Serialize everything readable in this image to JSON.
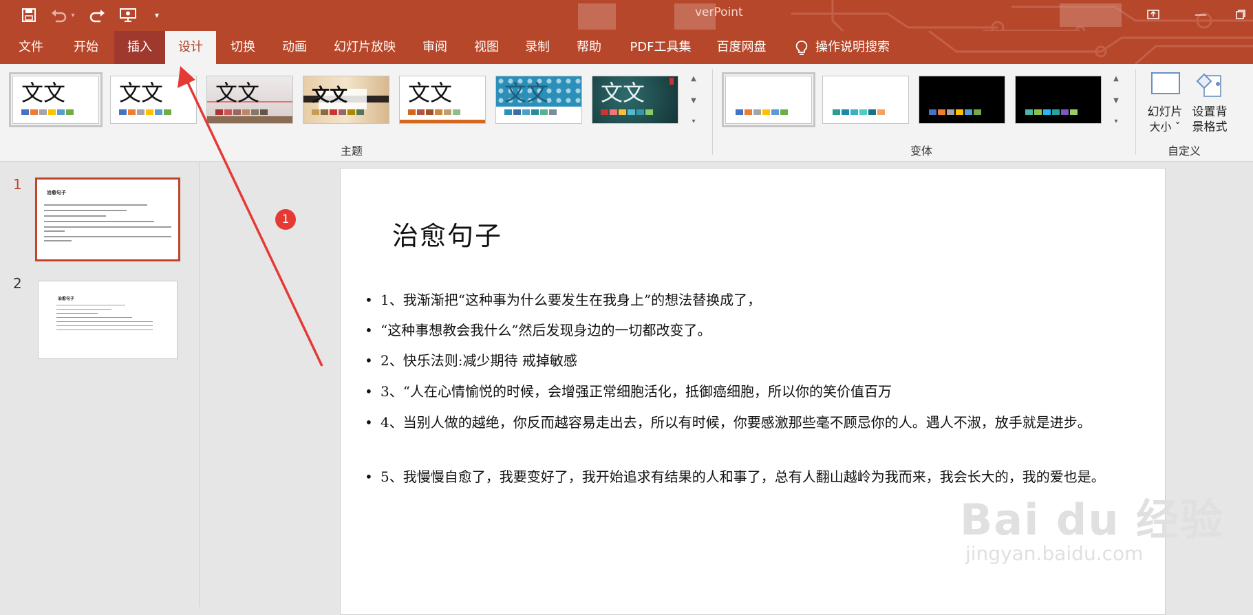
{
  "window": {
    "title_partial": "verPoint"
  },
  "colors": {
    "accent": "#b7472a",
    "accent_dark": "#a0392d",
    "ribbon_bg": "#f3f3f3",
    "annotation_red": "#e53935"
  },
  "quick_access": {
    "save_icon": "save-icon",
    "undo_icon": "undo-icon",
    "redo_icon": "redo-icon",
    "presenter_icon": "presentation-start-icon",
    "customize_icon": "customize-quick-access-icon"
  },
  "menu": {
    "tabs": [
      "文件",
      "开始",
      "插入",
      "设计",
      "切换",
      "动画",
      "幻灯片放映",
      "审阅",
      "视图",
      "录制",
      "帮助",
      "PDF工具集",
      "百度网盘"
    ],
    "active_tab": "设计",
    "highlighted_tab": "插入",
    "search_label": "操作说明搜索"
  },
  "ribbon": {
    "themes_group_label": "主题",
    "variants_group_label": "变体",
    "customize_group_label": "自定义",
    "theme_sample_text": "文文",
    "slide_size_label_1": "幻灯片",
    "slide_size_label_2": "大小 ˇ",
    "bg_format_label_1": "设置背",
    "bg_format_label_2": "景格式"
  },
  "slides_panel": {
    "slide_numbers": [
      "1",
      "2"
    ],
    "thumb_title": "治愈句子"
  },
  "slide": {
    "title": "治愈句子",
    "bullets": [
      "1、我渐渐把“这种事为什么要发生在我身上”的想法替换成了，",
      "“这种事想教会我什么”然后发现身边的一切都改变了。",
      "2、快乐法则:减少期待  戒掉敏感",
      "3、“人在心情愉悦的时候，会增强正常细胞活化，抵御癌细胞，所以你的笑价值百万",
      "4、当别人做的越绝，你反而越容易走出去，所以有时候，你要感激那些毫不顾忌你的人。遇人不淑，放手就是进步。",
      "5、我慢慢自愈了，我要变好了，我开始追求有结果的人和事了，总有人翻山越岭为我而来，我会长大的，我的爱也是。"
    ],
    "bullet_symbol": "•"
  },
  "annotation": {
    "marker_number": "1"
  },
  "watermark": {
    "line1": "Bai du 经验",
    "line2": "jingyan.baidu.com"
  }
}
